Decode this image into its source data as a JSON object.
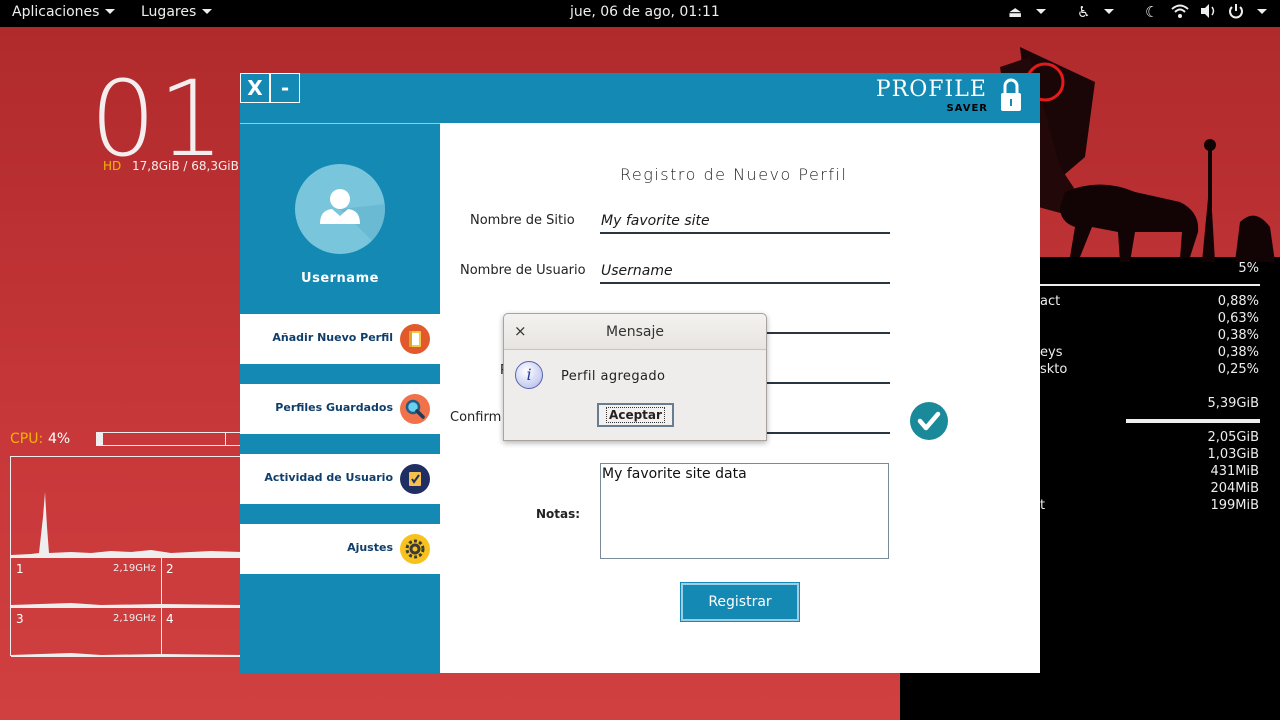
{
  "topbar": {
    "applications": "Aplicaciones",
    "places": "Lugares",
    "datetime": "jue, 06 de ago, 01:11"
  },
  "conky": {
    "clock": "01:",
    "hd_label": "HD",
    "hd_value": "17,8GiB / 68,3GiB",
    "cpu_label": "CPU:",
    "cpu_value": "4%",
    "cpu_usage": 0.04,
    "cores": [
      {
        "id": "1",
        "freq": "2,19GHz"
      },
      {
        "id": "2",
        "freq": ""
      },
      {
        "id": "3",
        "freq": "2,19GHz"
      },
      {
        "id": "4",
        "freq": ""
      }
    ],
    "right_top_value": "5%",
    "processes_cpu": [
      {
        "name": "act",
        "value": "0,88%"
      },
      {
        "name": "",
        "value": "0,63%"
      },
      {
        "name": "",
        "value": "0,38%"
      },
      {
        "name": "eys",
        "value": "0,38%"
      },
      {
        "name": "skto",
        "value": "0,25%"
      }
    ],
    "mem_value": "5,39GiB",
    "processes_mem": [
      {
        "name": "",
        "value": "2,05GiB"
      },
      {
        "name": "",
        "value": "1,03GiB"
      },
      {
        "name": "",
        "value": "431MiB"
      },
      {
        "name": "",
        "value": "204MiB"
      },
      {
        "name": "t",
        "value": "199MiB"
      }
    ]
  },
  "app": {
    "close_label": "X",
    "minimize_label": "-",
    "logo_title": "PROFILE",
    "logo_sub": "SAVER",
    "username": "Username",
    "nav": [
      {
        "label": "Añadir Nuevo Perfil",
        "icon": "add-profile-icon"
      },
      {
        "label": "Perfiles Guardados",
        "icon": "search-icon"
      },
      {
        "label": "Actividad de Usuario",
        "icon": "activity-icon"
      },
      {
        "label": "Ajustes",
        "icon": "gear-icon"
      }
    ],
    "form": {
      "title": "Registro de Nuevo Perfil",
      "site_label": "Nombre de Sitio",
      "site_value": "My favorite site",
      "user_label": "Nombre de Usuario",
      "user_value": "Username",
      "third_value": "",
      "pass_label_partial": "P",
      "pass_value": "",
      "confirm_label_partial": "Confirm",
      "confirm_value": "",
      "notes_label": "Notas:",
      "notes_value": "My favorite site data",
      "register_label": "Registrar"
    }
  },
  "dialog": {
    "title": "Mensaje",
    "close_glyph": "×",
    "message": "Perfil agregado",
    "ok_label": "Aceptar"
  },
  "colors": {
    "app_blue": "#1489b4",
    "wallpaper_red": "#c0393b",
    "conky_accent": "#f5b400"
  }
}
